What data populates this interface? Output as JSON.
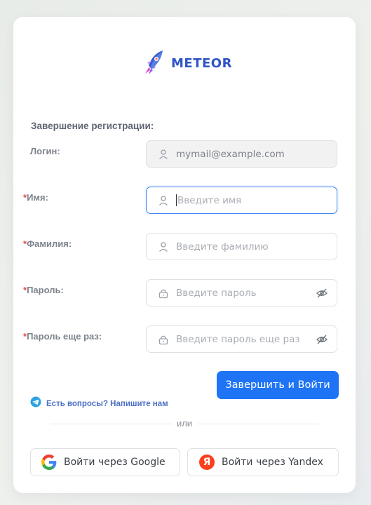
{
  "brand": {
    "name": "METEOR"
  },
  "form": {
    "title": "Завершение регистрации:",
    "login": {
      "label": "Логин",
      "value": "mymail@example.com"
    },
    "first_name": {
      "label": "Имя",
      "placeholder": "Введите имя",
      "required": true
    },
    "last_name": {
      "label": "Фамилия",
      "placeholder": "Введите фамилию",
      "required": true
    },
    "password": {
      "label": "Пароль",
      "placeholder": "Введите пароль",
      "required": true
    },
    "password_repeat": {
      "label": "Пароль еще раз",
      "placeholder": "Введите пароль еще раз",
      "required": true
    },
    "label_suffix": ":",
    "required_mark": "*"
  },
  "help_link": {
    "label": "Есть вопросы? Напишите нам",
    "icon": "telegram-icon"
  },
  "submit_button": {
    "label": "Завершить и Войти"
  },
  "separator": {
    "label": "или"
  },
  "social": {
    "google": {
      "label": "Войти через Google",
      "icon": "google-icon"
    },
    "yandex": {
      "label": "Войти через Yandex",
      "icon": "yandex-icon",
      "icon_letter": "Я"
    }
  },
  "colors": {
    "primary": "#1e74f5",
    "required": "#e34b4b",
    "brand": "#2f54c6"
  }
}
